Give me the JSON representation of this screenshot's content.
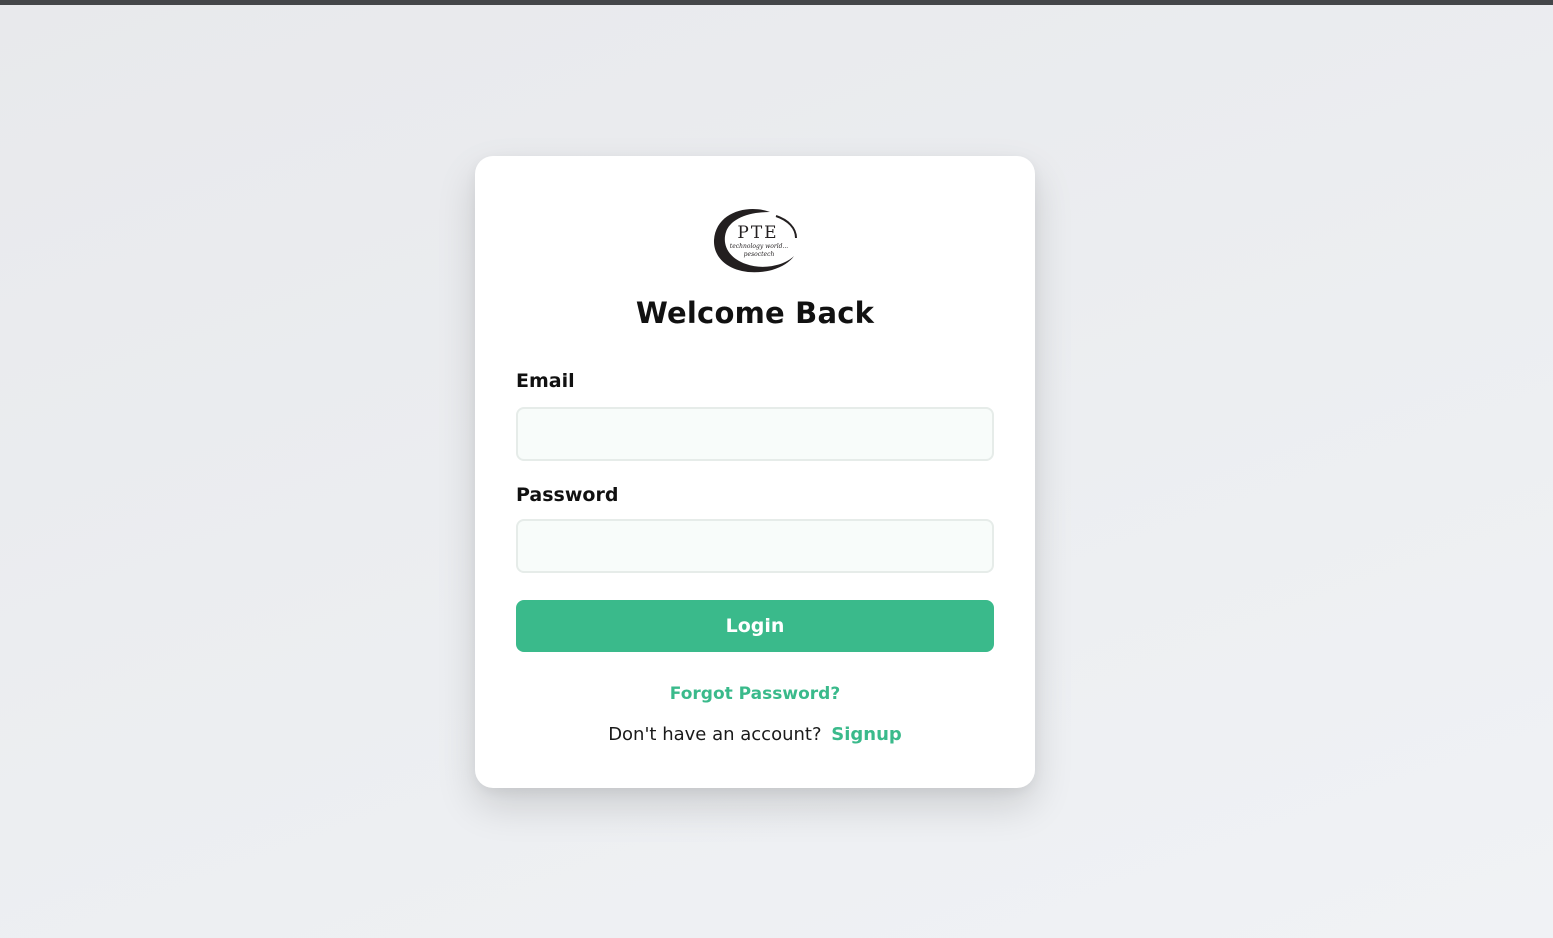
{
  "page": {
    "title": "Welcome Back"
  },
  "brand": {
    "logo_text": "PTE",
    "logo_tagline": "technology world...",
    "logo_sub": "pesoctech",
    "accent_color": "#3aba8b",
    "logo_icon": "pte-logo-icon"
  },
  "form": {
    "email_label": "Email",
    "email_value": "",
    "email_placeholder": "",
    "password_label": "Password",
    "password_value": "",
    "password_placeholder": "",
    "login_label": "Login",
    "forgot_label": "Forgot Password?",
    "signup_prompt": "Don't have an account?",
    "signup_label": "Signup"
  }
}
